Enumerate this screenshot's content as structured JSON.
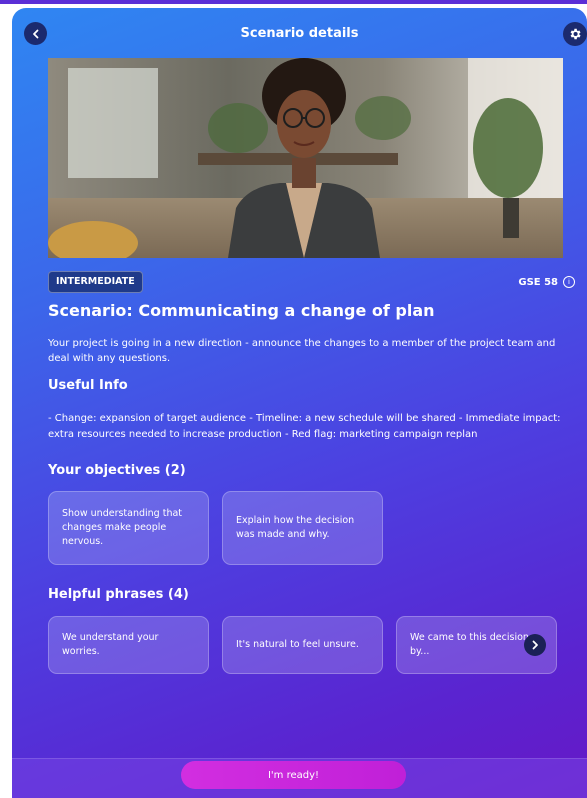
{
  "header": {
    "title": "Scenario details",
    "back_icon": "chevron-left-icon",
    "settings_icon": "gear-icon"
  },
  "hero": {
    "image": "avatar-woman-office-photo"
  },
  "level_badge": "INTERMEDIATE",
  "gse": "GSE 58",
  "scenario_title": "Scenario: Communicating a change of plan",
  "description": "Your project is going in a new direction - announce the changes to a member of the project team and deal with any questions.",
  "useful_info": {
    "heading": "Useful Info",
    "text": "- Change: expansion of target audience - Timeline: a new schedule will be shared - Immediate impact: extra resources needed to increase production - Red flag: marketing campaign replan"
  },
  "objectives": {
    "heading": "Your objectives (2)",
    "items": [
      "Show understanding that changes make people nervous.",
      "Explain how the decision was made and why."
    ]
  },
  "phrases": {
    "heading": "Helpful phrases (4)",
    "items": [
      "We understand your worries.",
      "It's natural to feel unsure.",
      "We came to this decision by..."
    ],
    "next_icon": "chevron-right-icon"
  },
  "footer": {
    "ready_label": "I'm ready!"
  },
  "colors": {
    "gradient_top": "#2f86f2",
    "gradient_bottom": "#6618c6",
    "cta": "#d22ee0"
  }
}
